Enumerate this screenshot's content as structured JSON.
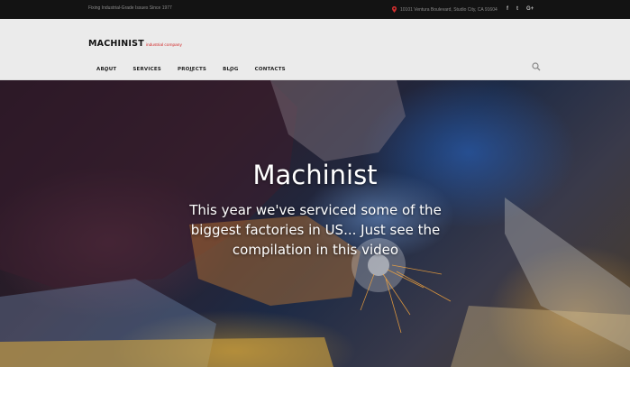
{
  "topbar": {
    "tagline": "Fixing Industrial-Grade Issues Since 1977",
    "address": "10101 Ventura Boulevard, Studio City, CA 91604",
    "address_icon": "map-pin-icon",
    "social": [
      {
        "label": "f",
        "icon": "facebook-icon"
      },
      {
        "label": "t",
        "icon": "twitter-icon"
      },
      {
        "label": "G+",
        "icon": "google-plus-icon"
      }
    ]
  },
  "header": {
    "brand": "MACHINIST",
    "brand_sub": "industrial company",
    "nav": [
      {
        "label": "ABOUT",
        "has_dropdown": true
      },
      {
        "label": "SERVICES",
        "has_dropdown": false
      },
      {
        "label": "PROJECTS",
        "has_dropdown": true
      },
      {
        "label": "BLOG",
        "has_dropdown": true
      },
      {
        "label": "CONTACTS",
        "has_dropdown": false
      }
    ],
    "search_icon": "search-icon"
  },
  "hero": {
    "title": "Machinist",
    "subtitle": "This year we've serviced some of the biggest factories in US... Just see the compilation in this video"
  },
  "colors": {
    "topbar_bg": "#131313",
    "header_bg": "#ebebeb",
    "accent": "#d32f2f"
  }
}
